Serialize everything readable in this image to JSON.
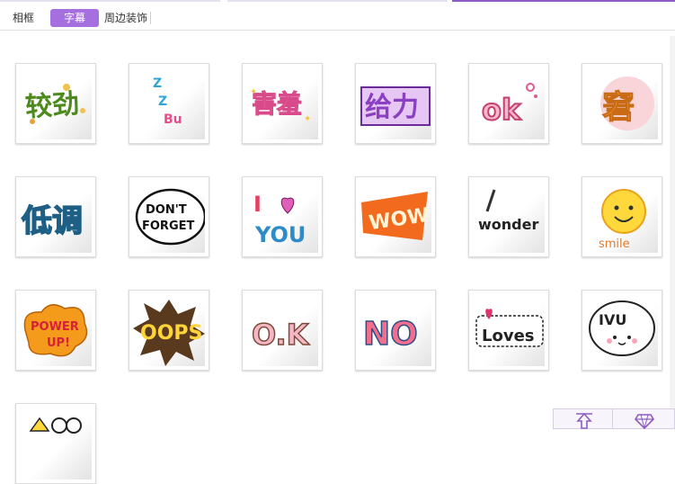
{
  "tabs": [
    {
      "label": "相框"
    },
    {
      "label": "字幕"
    },
    {
      "label": "周边装饰"
    }
  ],
  "active_tab": "字幕",
  "accent_color": "#a56fe0",
  "stickers": [
    {
      "name": "bixin-sticker",
      "text": "较劲"
    },
    {
      "name": "zzzbu-sticker",
      "text": "Z Z Bu"
    },
    {
      "name": "haixiu-sticker",
      "text": "害羞"
    },
    {
      "name": "geili-sticker",
      "text": "给力"
    },
    {
      "name": "ok-sticker",
      "text": "ok"
    },
    {
      "name": "jiong-sticker",
      "text": "窘"
    },
    {
      "name": "didiao-sticker",
      "text": "低调"
    },
    {
      "name": "dont-forget-sticker",
      "text": "DON'T FORGET"
    },
    {
      "name": "i-love-you-sticker",
      "text": "I ♥ YOU"
    },
    {
      "name": "wow-sticker",
      "text": "WOW"
    },
    {
      "name": "wonder-sticker",
      "text": "wonder"
    },
    {
      "name": "smile-sticker",
      "text": "smile"
    },
    {
      "name": "power-up-sticker",
      "text": "POWER UP!"
    },
    {
      "name": "oops-sticker",
      "text": "OOPS!"
    },
    {
      "name": "o-k-sticker",
      "text": "O.K"
    },
    {
      "name": "no-sticker",
      "text": "NO"
    },
    {
      "name": "loves-sticker",
      "text": "Loves"
    },
    {
      "name": "ivu-sticker",
      "text": "IVU"
    },
    {
      "name": "partial-sticker",
      "text": ""
    }
  ],
  "bottom_buttons": [
    {
      "name": "upload-icon"
    },
    {
      "name": "diamond-icon"
    }
  ]
}
